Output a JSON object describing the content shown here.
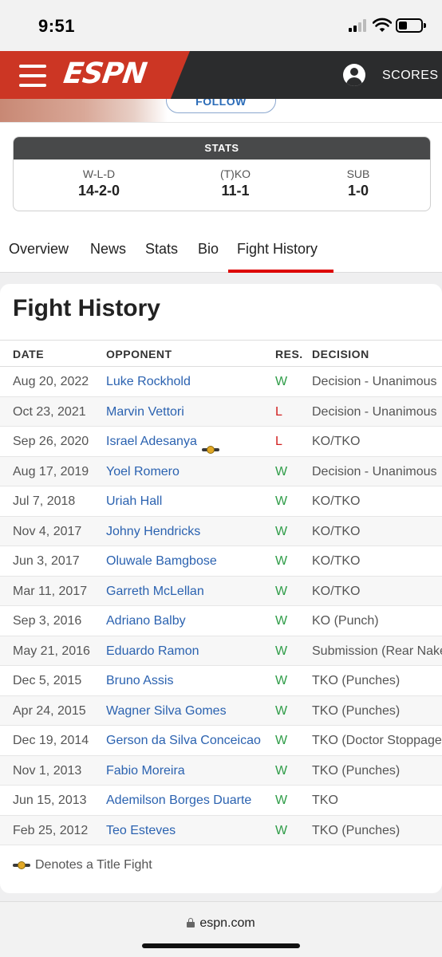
{
  "status_bar": {
    "time": "9:51"
  },
  "header": {
    "logo": "ESPN",
    "scores_label": "SCORES"
  },
  "profile": {
    "follow_label": "FOLLOW"
  },
  "stats": {
    "heading": "STATS",
    "items": [
      {
        "label": "W-L-D",
        "value": "14-2-0"
      },
      {
        "label": "(T)KO",
        "value": "11-1"
      },
      {
        "label": "SUB",
        "value": "1-0"
      }
    ]
  },
  "tabs": [
    {
      "label": "Overview",
      "active": false
    },
    {
      "label": "News",
      "active": false
    },
    {
      "label": "Stats",
      "active": false
    },
    {
      "label": "Bio",
      "active": false
    },
    {
      "label": "Fight History",
      "active": true
    }
  ],
  "fight_history": {
    "title": "Fight History",
    "columns": [
      "DATE",
      "OPPONENT",
      "RES.",
      "DECISION"
    ],
    "rows": [
      {
        "date": "Aug 20, 2022",
        "opponent": "Luke Rockhold",
        "result": "W",
        "decision": "Decision - Unanimous",
        "title_fight": false
      },
      {
        "date": "Oct 23, 2021",
        "opponent": "Marvin Vettori",
        "result": "L",
        "decision": "Decision - Unanimous",
        "title_fight": false
      },
      {
        "date": "Sep 26, 2020",
        "opponent": "Israel Adesanya",
        "result": "L",
        "decision": "KO/TKO",
        "title_fight": true
      },
      {
        "date": "Aug 17, 2019",
        "opponent": "Yoel Romero",
        "result": "W",
        "decision": "Decision - Unanimous",
        "title_fight": false
      },
      {
        "date": "Jul 7, 2018",
        "opponent": "Uriah Hall",
        "result": "W",
        "decision": "KO/TKO",
        "title_fight": false
      },
      {
        "date": "Nov 4, 2017",
        "opponent": "Johny Hendricks",
        "result": "W",
        "decision": "KO/TKO",
        "title_fight": false
      },
      {
        "date": "Jun 3, 2017",
        "opponent": "Oluwale Bamgbose",
        "result": "W",
        "decision": "KO/TKO",
        "title_fight": false
      },
      {
        "date": "Mar 11, 2017",
        "opponent": "Garreth McLellan",
        "result": "W",
        "decision": "KO/TKO",
        "title_fight": false
      },
      {
        "date": "Sep 3, 2016",
        "opponent": "Adriano Balby",
        "result": "W",
        "decision": "KO (Punch)",
        "title_fight": false
      },
      {
        "date": "May 21, 2016",
        "opponent": "Eduardo Ramon",
        "result": "W",
        "decision": "Submission (Rear Naked Choke)",
        "title_fight": false
      },
      {
        "date": "Dec 5, 2015",
        "opponent": "Bruno Assis",
        "result": "W",
        "decision": "TKO (Punches)",
        "title_fight": false
      },
      {
        "date": "Apr 24, 2015",
        "opponent": "Wagner Silva Gomes",
        "result": "W",
        "decision": "TKO (Punches)",
        "title_fight": false
      },
      {
        "date": "Dec 19, 2014",
        "opponent": "Gerson da Silva Conceicao",
        "result": "W",
        "decision": "TKO (Doctor Stoppage)",
        "title_fight": false
      },
      {
        "date": "Nov 1, 2013",
        "opponent": "Fabio Moreira",
        "result": "W",
        "decision": "TKO (Punches)",
        "title_fight": false
      },
      {
        "date": "Jun 15, 2013",
        "opponent": "Ademilson Borges Duarte",
        "result": "W",
        "decision": "TKO",
        "title_fight": false
      },
      {
        "date": "Feb 25, 2012",
        "opponent": "Teo Esteves",
        "result": "W",
        "decision": "TKO (Punches)",
        "title_fight": false
      }
    ],
    "legend": "Denotes a Title Fight"
  },
  "browser": {
    "url": "espn.com"
  },
  "colors": {
    "espn_red": "#cc3624",
    "win": "#2e9c47",
    "loss": "#d11f1f",
    "link": "#2b62b0"
  }
}
